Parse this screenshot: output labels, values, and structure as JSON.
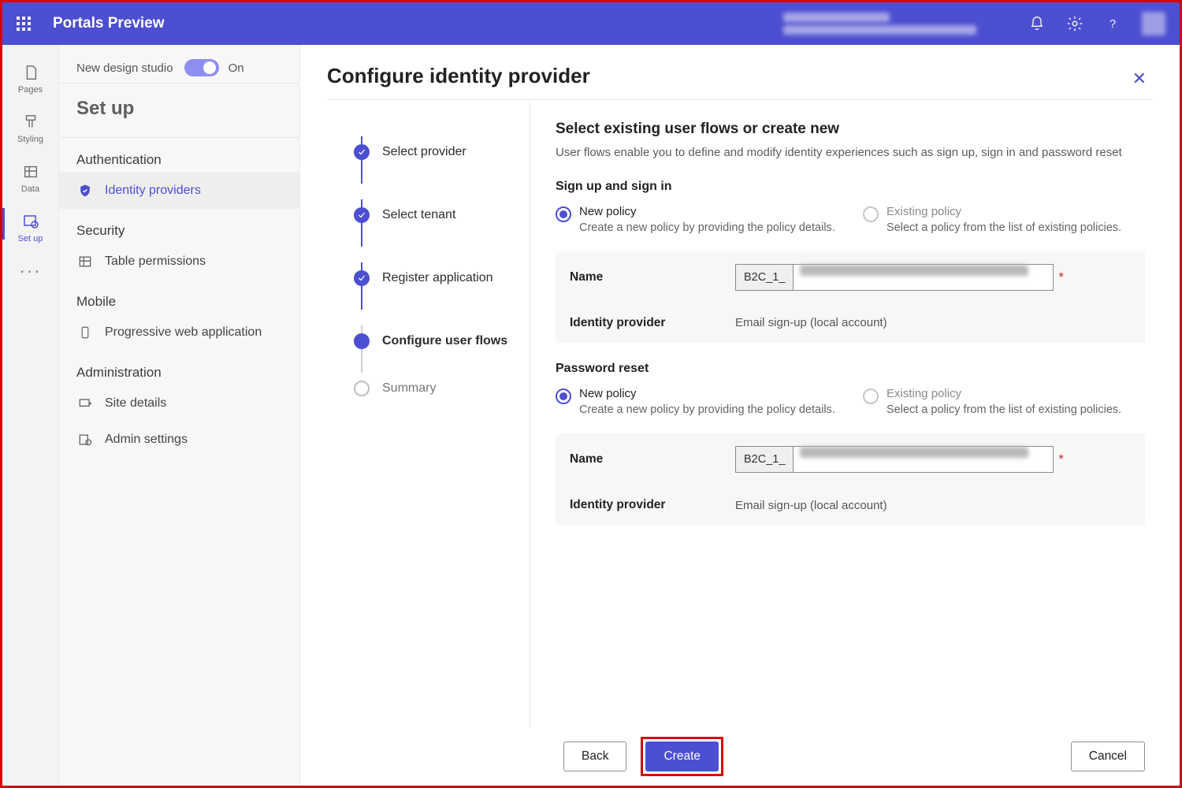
{
  "app": {
    "title": "Portals Preview"
  },
  "toggle": {
    "label": "New design studio",
    "state": "On"
  },
  "rail": {
    "items": [
      {
        "id": "pages",
        "label": "Pages"
      },
      {
        "id": "styling",
        "label": "Styling"
      },
      {
        "id": "data",
        "label": "Data"
      },
      {
        "id": "setup",
        "label": "Set up"
      }
    ]
  },
  "leftpanel": {
    "title": "Set up",
    "sections": {
      "auth": {
        "header": "Authentication",
        "items": [
          "Identity providers"
        ]
      },
      "security": {
        "header": "Security",
        "items": [
          "Table permissions"
        ]
      },
      "mobile": {
        "header": "Mobile",
        "items": [
          "Progressive web application"
        ]
      },
      "admin": {
        "header": "Administration",
        "items": [
          "Site details",
          "Admin settings"
        ]
      }
    }
  },
  "panel": {
    "title": "Configure identity provider",
    "steps": [
      "Select provider",
      "Select tenant",
      "Register application",
      "Configure user flows",
      "Summary"
    ],
    "heading": "Select existing user flows or create new",
    "sub": "User flows enable you to define and modify identity experiences such as sign up, sign in and password reset",
    "section_signup": "Sign up and sign in",
    "section_pwd": "Password reset",
    "radio": {
      "new_label": "New policy",
      "new_desc": "Create a new policy by providing the policy details.",
      "existing_label": "Existing policy",
      "existing_desc": "Select a policy from the list of existing policies."
    },
    "fields": {
      "name_label": "Name",
      "name_prefix": "B2C_1_",
      "idp_label": "Identity provider",
      "idp_value": "Email sign-up (local account)"
    },
    "buttons": {
      "back": "Back",
      "create": "Create",
      "cancel": "Cancel"
    }
  }
}
